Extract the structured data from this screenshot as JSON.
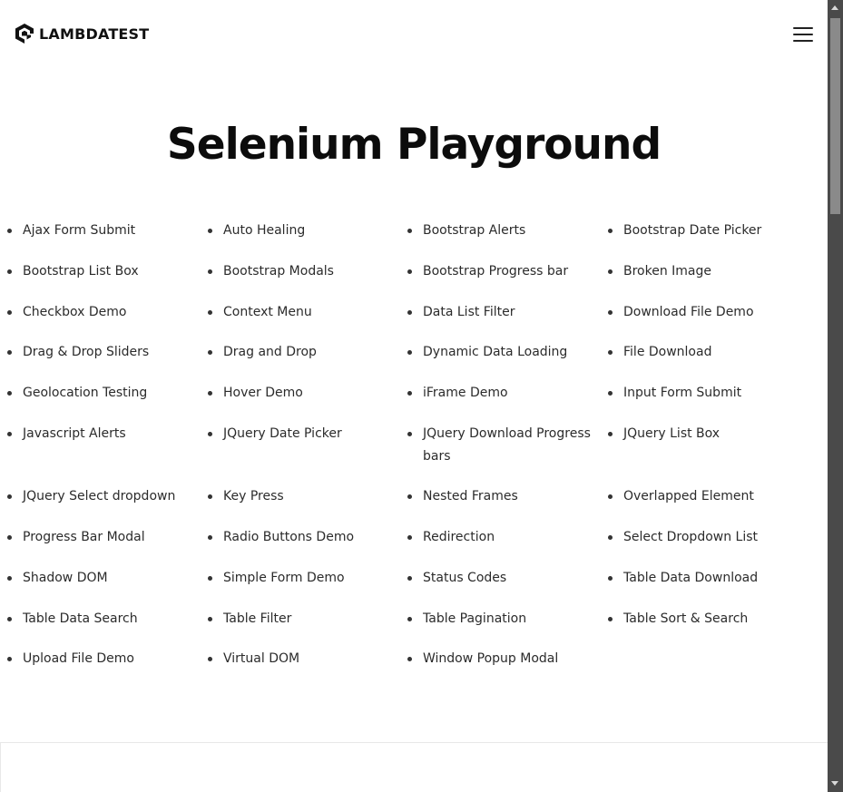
{
  "header": {
    "logo_text": "LAMBDATEST",
    "menu_icon": "hamburger-menu-icon"
  },
  "page": {
    "title": "Selenium Playground"
  },
  "links": [
    "Ajax Form Submit",
    "Auto Healing",
    "Bootstrap Alerts",
    "Bootstrap Date Picker",
    "Bootstrap List Box",
    "Bootstrap Modals",
    "Bootstrap Progress bar",
    "Broken Image",
    "Checkbox Demo",
    "Context Menu",
    "Data List Filter",
    "Download File Demo",
    "Drag & Drop Sliders",
    "Drag and Drop",
    "Dynamic Data Loading",
    "File Download",
    "Geolocation Testing",
    "Hover Demo",
    "iFrame Demo",
    "Input Form Submit",
    "Javascript Alerts",
    "JQuery Date Picker",
    "JQuery Download Progress bars",
    "JQuery List Box",
    "JQuery Select dropdown",
    "Key Press",
    "Nested Frames",
    "Overlapped Element",
    "Progress Bar Modal",
    "Radio Buttons Demo",
    "Redirection",
    "Select Dropdown List",
    "Shadow DOM",
    "Simple Form Demo",
    "Status Codes",
    "Table Data Download",
    "Table Data Search",
    "Table Filter",
    "Table Pagination",
    "Table Sort & Search",
    "Upload File Demo",
    "Virtual DOM",
    "Window Popup Modal"
  ]
}
